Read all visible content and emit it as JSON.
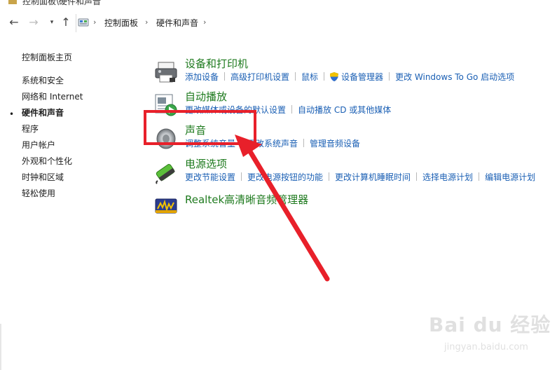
{
  "window": {
    "title": "控制面板\\硬件和声音"
  },
  "nav": {
    "back_icon": "arrow-left-icon",
    "forward_icon": "arrow-right-icon",
    "recent_icon": "chevron-down-icon",
    "up_icon": "arrow-up-icon",
    "breadcrumbs": [
      "控制面板",
      "硬件和声音"
    ]
  },
  "sidebar": {
    "items": [
      {
        "label": "控制面板主页"
      },
      {
        "label": "系统和安全"
      },
      {
        "label": "网络和 Internet"
      },
      {
        "label": "硬件和声音",
        "active": true
      },
      {
        "label": "程序"
      },
      {
        "label": "用户帐户"
      },
      {
        "label": "外观和个性化"
      },
      {
        "label": "时钟和区域"
      },
      {
        "label": "轻松使用"
      }
    ]
  },
  "categories": [
    {
      "title": "设备和打印机",
      "icon": "printer-icon",
      "links": [
        "添加设备",
        "高级打印机设置",
        "鼠标",
        "设备管理器",
        "更改 Windows To Go 启动选项"
      ]
    },
    {
      "title": "自动播放",
      "icon": "autoplay-icon",
      "links": [
        "更改媒体或设备的默认设置",
        "自动播放 CD 或其他媒体"
      ]
    },
    {
      "title": "声音",
      "icon": "speaker-icon",
      "links": [
        "调整系统音量",
        "更改系统声音",
        "管理音频设备"
      ]
    },
    {
      "title": "电源选项",
      "icon": "battery-icon",
      "links": [
        "更改节能设置",
        "更改电源按钮的功能",
        "更改计算机睡眠时间",
        "选择电源计划",
        "编辑电源计划"
      ]
    },
    {
      "title": "Realtek高清晰音频管理器",
      "icon": "realtek-audio-icon",
      "links": []
    }
  ],
  "annotation": {
    "highlight_color": "#e8202a"
  },
  "watermark": {
    "logo": "Bai du 经验",
    "url": "jingyan.baidu.com"
  },
  "colors": {
    "link": "#1a5fb4",
    "category_title": "#1e7a1e"
  }
}
